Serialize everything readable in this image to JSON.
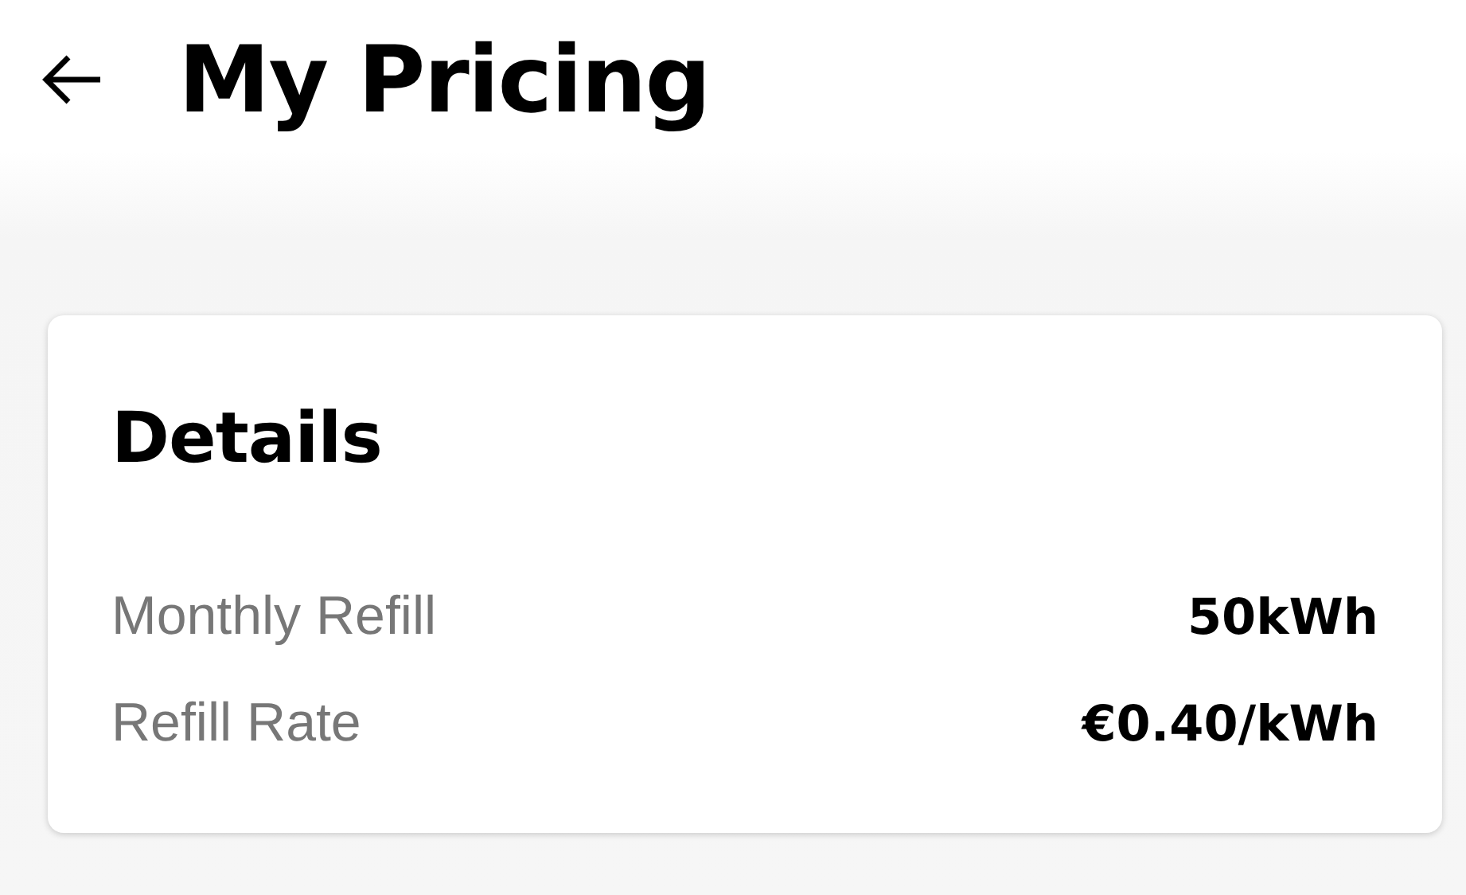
{
  "header": {
    "title": "My Pricing"
  },
  "card": {
    "title": "Details",
    "rows": [
      {
        "label": "Monthly Refill",
        "value": "50kWh"
      },
      {
        "label": "Refill Rate",
        "value": "€0.40/kWh"
      }
    ]
  }
}
